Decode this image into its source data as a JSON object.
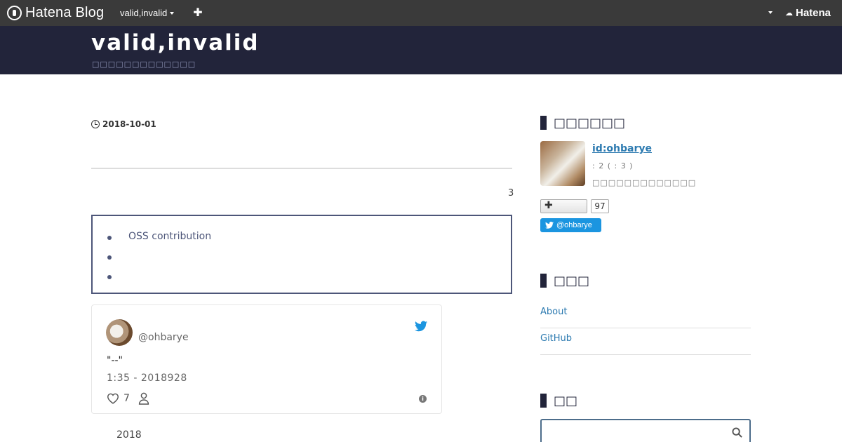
{
  "topbar": {
    "brand": "Hatena Blog",
    "blog_menu": "valid,invalid",
    "add_symbol": "✚",
    "hatena": "Hatena"
  },
  "header": {
    "title": "valid,invalid",
    "description": "□□□□□□□□□□□□□"
  },
  "entry": {
    "date": "2018-10-01",
    "count": "3",
    "toc": [
      "OSS contribution",
      "",
      ""
    ]
  },
  "tweet": {
    "handle": "@ohbarye",
    "text": "\"--\"",
    "time": "1:35 - 2018928",
    "likes": "7"
  },
  "archive": {
    "year": "2018"
  },
  "sidebar": {
    "profile": {
      "title": "□□□□□□",
      "id": "id:ohbarye",
      "readers": ": 2 (      : 3  )",
      "description": "□□□□□□□□□□□□□",
      "reader_count": "97",
      "twitter_follow": "@ohbarye"
    },
    "links": {
      "title": "□□□",
      "items": [
        "About",
        "GitHub"
      ]
    },
    "search": {
      "title": "□□",
      "placeholder": ""
    }
  },
  "colors": {
    "topbar": "#3a3a3a",
    "header": "#22243a",
    "accent": "#4d5679",
    "link": "#2c7ab0",
    "twitter": "#1b95e0"
  }
}
